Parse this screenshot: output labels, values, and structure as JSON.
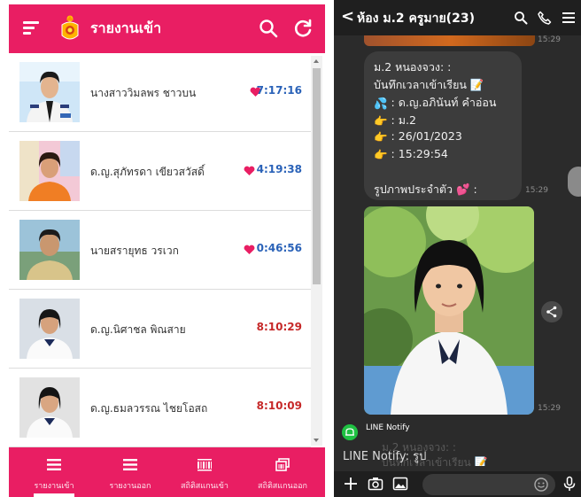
{
  "left_app": {
    "title": "รายงานเข้า",
    "accent_color": "#e91e63",
    "header_icons": [
      "menu-icon",
      "school-logo",
      "search-icon",
      "refresh-icon"
    ],
    "students": [
      {
        "name": "นางสาววิมลพร ชาวบน",
        "time": "7:17:16",
        "heart": true,
        "time_color": "#2a62b8"
      },
      {
        "name": "ด.ญ.สุภัทรดา เขียวสวัสดิ์",
        "time": "4:19:38",
        "heart": true,
        "time_color": "#2a62b8"
      },
      {
        "name": "นายสรายุทธ วรเวก",
        "time": "0:46:56",
        "heart": true,
        "time_color": "#2a62b8"
      },
      {
        "name": "ด.ญ.นิศาชล พิณสาย",
        "time": "8:10:29",
        "heart": false,
        "time_color": "#c62828"
      },
      {
        "name": "ด.ญ.ธมลวรรณ ไชยโอสถ",
        "time": "8:10:09",
        "heart": false,
        "time_color": "#c62828"
      }
    ],
    "nav": [
      {
        "label": "รายงานเข้า",
        "icon": "list-icon",
        "active": true
      },
      {
        "label": "รายงานออก",
        "icon": "list-icon",
        "active": false
      },
      {
        "label": "สถิติสแกนเข้า",
        "icon": "barcode-icon",
        "active": false
      },
      {
        "label": "สถิติสแกนออก",
        "icon": "scan-icon",
        "active": false
      }
    ]
  },
  "right_app": {
    "chat_title": "ห้อง ม.2 ครูมาย(23)",
    "header_icons": [
      "search-icon",
      "phone-icon",
      "menu-icon"
    ],
    "top_timestamp": "15:29",
    "message": {
      "lines": [
        {
          "emoji": "",
          "text": "ม.2 หนองจวง: :"
        },
        {
          "emoji": "",
          "text": "บันทึกเวลาเข้าเรียน 📝"
        },
        {
          "emoji": "💦",
          "text": " : ด.ญ.อภินันท์  คำอ่อน"
        },
        {
          "emoji": "👉",
          "text": " : ม.2"
        },
        {
          "emoji": "👉",
          "text": " : 26/01/2023"
        },
        {
          "emoji": "👉",
          "text": " : 15:29:54"
        },
        {
          "emoji": "",
          "text": ""
        },
        {
          "emoji": "",
          "text": "รูปภาพประจำตัว 💕 :"
        }
      ],
      "timestamp": "15:29"
    },
    "photo_timestamp": "15:29",
    "sender": "LINE Notify",
    "ghost_lines": [
      "ม.2 หนองจวง: :",
      "บันทึกเวลาเข้าเรียน 📝"
    ],
    "notification_preview": "LINE Notify: รูป",
    "footer_icons": [
      "plus-icon",
      "camera-icon",
      "image-icon",
      "emoji-icon",
      "mic-icon"
    ]
  }
}
